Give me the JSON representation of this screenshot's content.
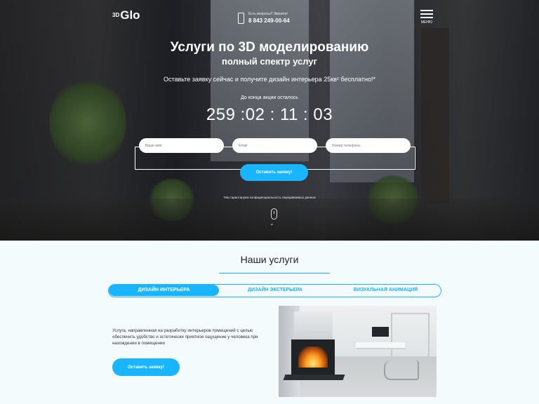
{
  "header": {
    "logo_sup": "3D",
    "logo_text": "Glo",
    "phone_question": "Есть вопросы? Звоните!",
    "phone_number": "8 843 249-00-64",
    "menu_label": "МЕНЮ"
  },
  "hero": {
    "title": "Услуги по 3D моделированию",
    "subtitle": "полный спектр услуг",
    "offer": "Оставьте заявку сейчас и получите дизайн интерьера 25кв² бесплатно!*",
    "countdown_label": "До конца акции осталось",
    "countdown": "259 :02 : 11 : 03",
    "form": {
      "name_placeholder": "Ваше имя",
      "email_placeholder": "Email",
      "phone_placeholder": "Номер телефона",
      "submit_label": "Оставить заявку!"
    },
    "privacy_note": "*Мы гарантируем конфиденциальность передаваемых данных"
  },
  "services": {
    "title": "Наши услуги",
    "tabs": [
      {
        "label": "ДИЗАЙН ИНТЕРЬЕРА",
        "active": true
      },
      {
        "label": "ДИЗАЙН ЭКСТЕРЬЕРА",
        "active": false
      },
      {
        "label": "ВИЗУАЛЬНАЯ АНИМАЦИЯ",
        "active": false
      }
    ],
    "description": "Услуга, направленная на разработку интерьеров помещений с целью обеспечить удобство и эстетически приятное ощущение у человека при нахождении в помещении",
    "button_label": "Оставить заявку!"
  },
  "colors": {
    "accent": "#19b5fe",
    "section_bg": "#f3fbfd"
  },
  "icons": [
    "phone-icon",
    "menu-icon",
    "scroll-mouse-icon"
  ]
}
